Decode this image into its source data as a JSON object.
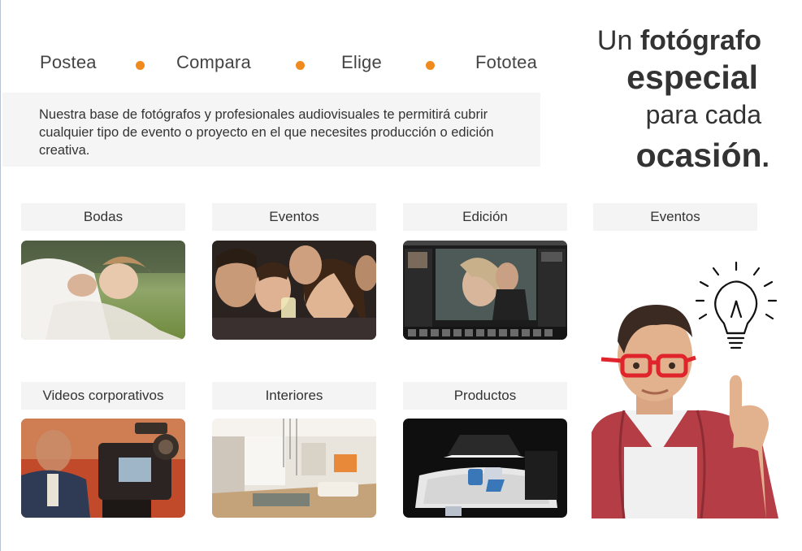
{
  "steps": [
    "Postea",
    "Compara",
    "Elige",
    "Fototea"
  ],
  "intro": "Nuestra base de fotógrafos  y profesionales audiovisuales te permitirá cubrir cualquier tipo de evento o proyecto en el que necesites producción o edición creativa.",
  "slogan": {
    "line1_pre": "Un ",
    "line1_bold": "fotógrafo",
    "line2": "especial",
    "line3": "para cada",
    "line4": "ocasión",
    "line4_suffix": "."
  },
  "categories": [
    {
      "label": "Bodas"
    },
    {
      "label": "Eventos"
    },
    {
      "label": "Edición"
    },
    {
      "label": "Eventos"
    },
    {
      "label": "Videos corporativos"
    },
    {
      "label": "Interiores"
    },
    {
      "label": "Productos"
    }
  ],
  "colors": {
    "accent": "#f08a1c",
    "label_bg": "#f5f4f4",
    "text": "#333333"
  }
}
